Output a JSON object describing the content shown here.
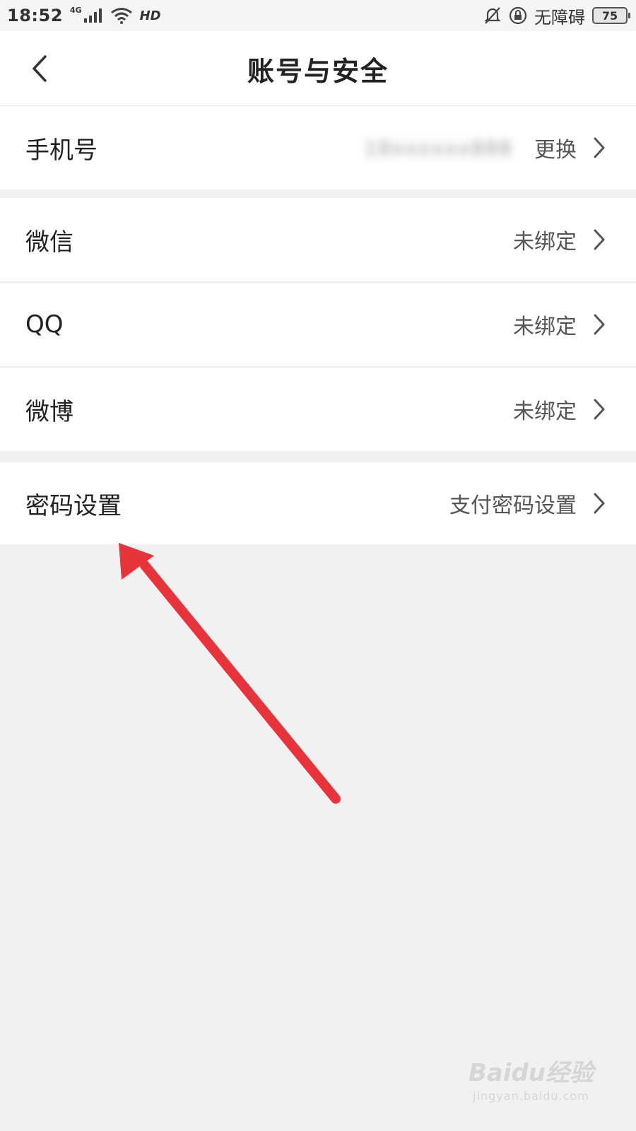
{
  "status_bar": {
    "time": "18:52",
    "network": "4G",
    "hd": "HD",
    "accessibility": "无障碍",
    "battery": "75"
  },
  "nav": {
    "title": "账号与安全",
    "back_icon": "chevron-left-icon"
  },
  "rows": {
    "phone": {
      "label": "手机号",
      "value_hidden": "18xxxxxx888",
      "action": "更换"
    },
    "wechat": {
      "label": "微信",
      "value": "未绑定"
    },
    "qq": {
      "label": "QQ",
      "value": "未绑定"
    },
    "weibo": {
      "label": "微博",
      "value": "未绑定"
    },
    "password": {
      "label": "密码设置",
      "value": "支付密码设置"
    }
  },
  "annotation": {
    "arrow_color": "#e8333b"
  },
  "watermark": {
    "logo": "Baidu经验",
    "url": "jingyan.baidu.com"
  }
}
